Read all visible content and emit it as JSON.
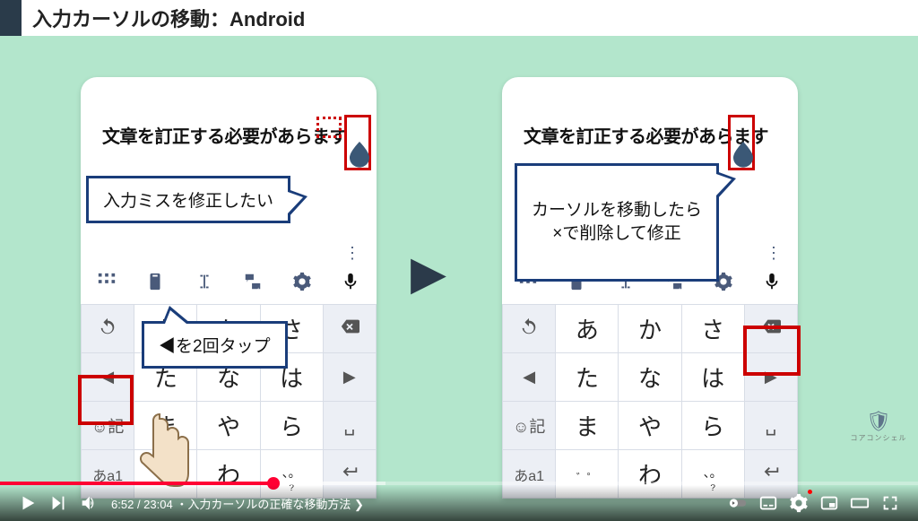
{
  "slide": {
    "title": "入力カーソルの移動：Android"
  },
  "phone": {
    "text": "文章を訂正する必要があらます"
  },
  "callouts": {
    "left_top": "入力ミスを修正したい",
    "left_bottom": "◀を2回タップ",
    "right": "カーソルを移動したら\n×で削除して修正"
  },
  "keys": {
    "row1": [
      "あ",
      "か",
      "さ"
    ],
    "row2": [
      "た",
      "な",
      "は"
    ],
    "row3": [
      "ま",
      "や",
      "ら"
    ],
    "row4_center": "わ",
    "emoji_kanji": "☺記",
    "mode": "あa1",
    "left_arrow": "◀",
    "right_arrow": "▶",
    "space": "␣",
    "dakuten": "゛゜",
    "question": "?"
  },
  "player": {
    "time_current": "6:52",
    "time_total": "23:04",
    "chapter": "・入力カーソルの正確な移動方法",
    "progress_played_pct": 29.8,
    "progress_buffered_pct": 42
  },
  "watermark": {
    "text": "コアコンシェル"
  }
}
